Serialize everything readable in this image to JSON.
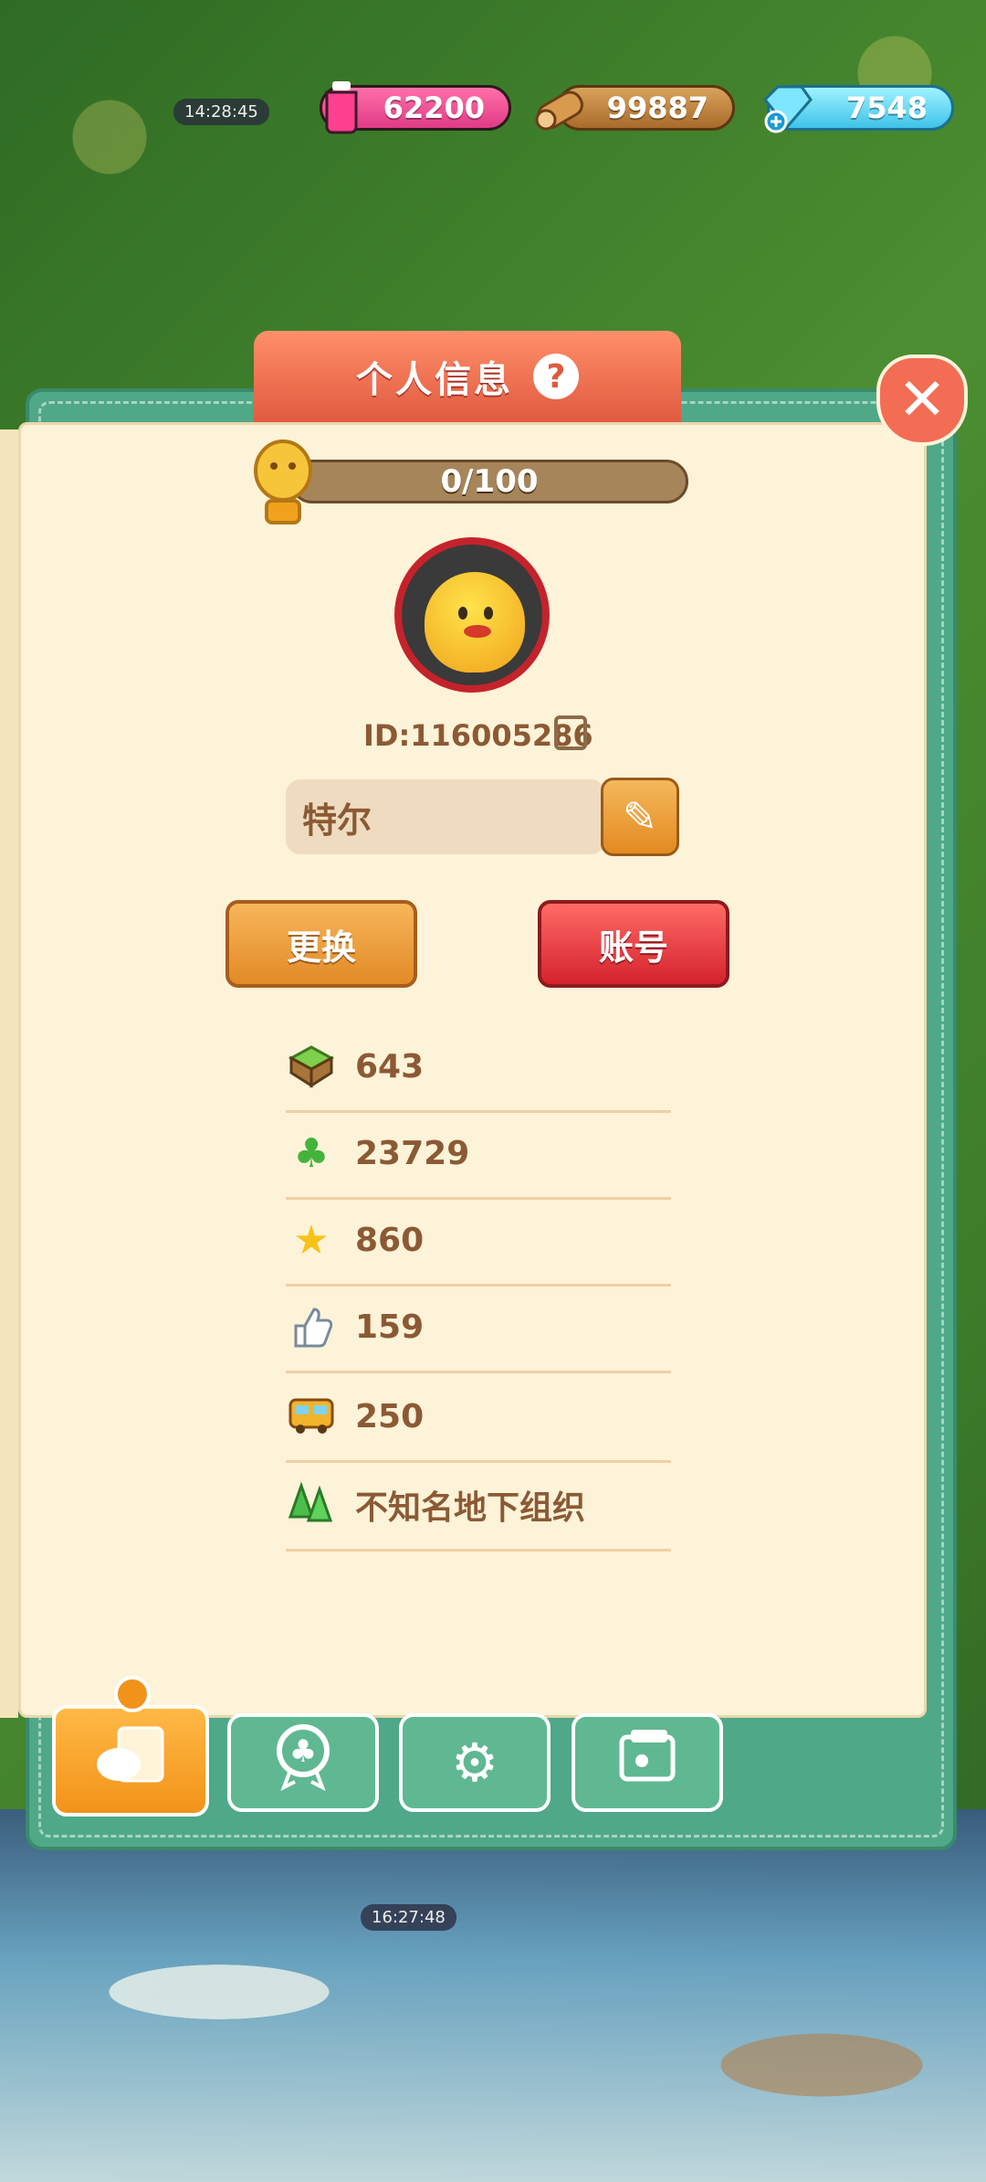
{
  "timers": {
    "top": "14:28:45",
    "bottom": "16:27:48"
  },
  "resources": {
    "potion": {
      "value": "62200",
      "icon": "potion-icon"
    },
    "wood": {
      "value": "99887",
      "icon": "wood-log-icon"
    },
    "gems": {
      "value": "7548",
      "icon": "gem-icon"
    }
  },
  "panel": {
    "title": "个人信息",
    "help_label": "?",
    "close_label": "✕",
    "progress": {
      "text": "0/100",
      "fraction": 0.0
    },
    "user_id": "ID:116005286",
    "username": "特尔",
    "buttons": {
      "change": "更换",
      "account": "账号"
    },
    "stats": [
      {
        "icon": "land-block-icon",
        "value": "643"
      },
      {
        "icon": "clover-icon",
        "value": "23729"
      },
      {
        "icon": "star-icon",
        "value": "860"
      },
      {
        "icon": "thumbs-up-icon",
        "value": "159"
      },
      {
        "icon": "bus-icon",
        "value": "250"
      },
      {
        "icon": "trees-icon",
        "value": "不知名地下组织"
      }
    ]
  },
  "tabs": [
    {
      "name": "profile-card-tab",
      "icon": "profile-card-icon"
    },
    {
      "name": "badge-tab",
      "icon": "badge-icon"
    },
    {
      "name": "settings-tab",
      "icon": "gear-icon"
    },
    {
      "name": "photo-album-tab",
      "icon": "photo-album-icon"
    }
  ],
  "colors": {
    "panel_title": "#e05a3f",
    "panel_frame": "#4fa888",
    "page": "#fdf3d8",
    "text_brown": "#8b5a35"
  }
}
